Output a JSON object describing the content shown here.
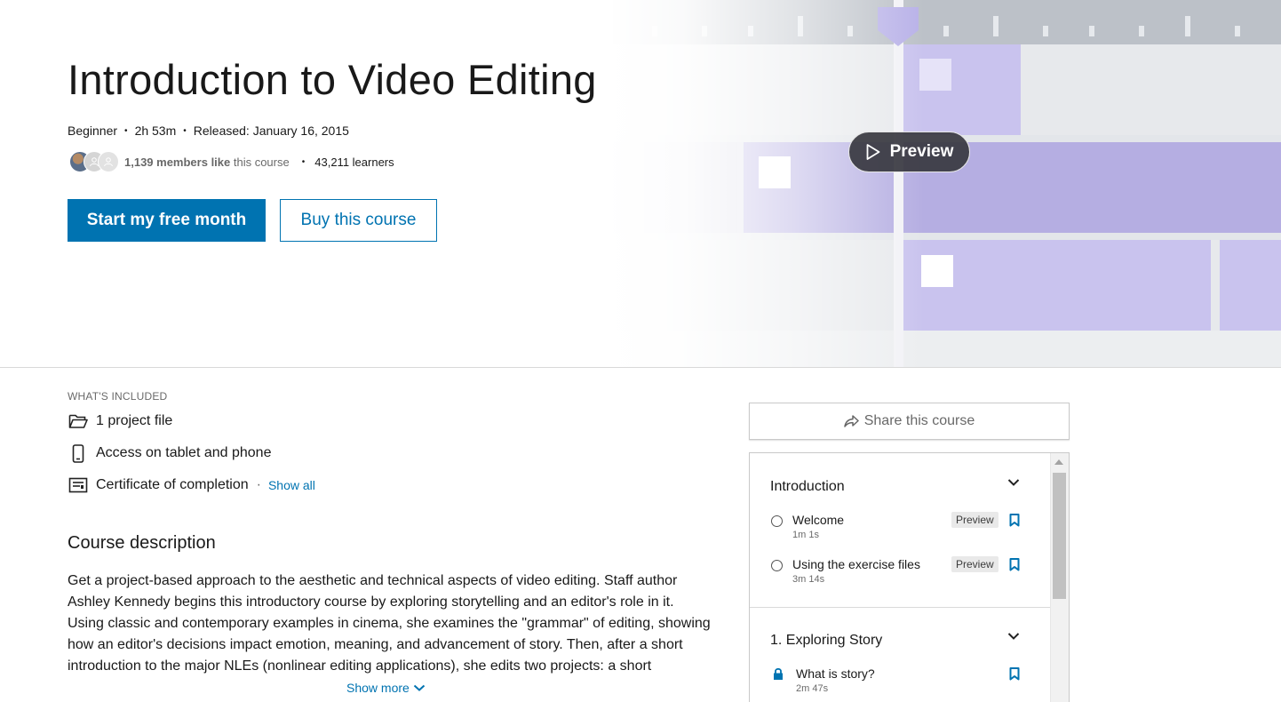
{
  "course": {
    "title": "Introduction to Video Editing",
    "level": "Beginner",
    "duration": "2h 53m",
    "released": "Released: January 16, 2015",
    "members_count": "1,139 members like",
    "members_suffix": " this course",
    "learners": "43,211 learners"
  },
  "actions": {
    "primary_label": "Start my free month",
    "secondary_label": "Buy this course",
    "preview_label": "Preview"
  },
  "included": {
    "label": "WHAT'S INCLUDED",
    "items": [
      {
        "icon": "folder-icon",
        "label": "1 project file"
      },
      {
        "icon": "phone-icon",
        "label": "Access on tablet and phone"
      },
      {
        "icon": "certificate-icon",
        "label": "Certificate of completion"
      }
    ],
    "show_all": "Show all",
    "separator": "·"
  },
  "description": {
    "heading": "Course description",
    "body": "Get a project-based approach to the aesthetic and technical aspects of video editing. Staff author Ashley Kennedy begins this introductory course by exploring storytelling and an editor's role in it. Using classic and contemporary examples in cinema, she examines the \"grammar\" of editing, showing how an editor's decisions impact emotion, meaning, and advancement of story. Then, after a short introduction to the major NLEs (nonlinear editing applications), she edits two projects: a short",
    "show_more": "Show more"
  },
  "sidebar": {
    "share_label": "Share this course",
    "chapters": [
      {
        "title": "Introduction",
        "videos": [
          {
            "title": "Welcome",
            "duration": "1m 1s",
            "badge": "Preview",
            "locked": false
          },
          {
            "title": "Using the exercise files",
            "duration": "3m 14s",
            "badge": "Preview",
            "locked": false
          }
        ]
      },
      {
        "title": "1. Exploring Story",
        "videos": [
          {
            "title": "What is story?",
            "duration": "2m 47s",
            "badge": "",
            "locked": true
          }
        ]
      }
    ]
  },
  "colors": {
    "brand_blue": "#0073b1",
    "timeline_purple": "#b9b3e3",
    "playhead": "#b5aee6"
  }
}
